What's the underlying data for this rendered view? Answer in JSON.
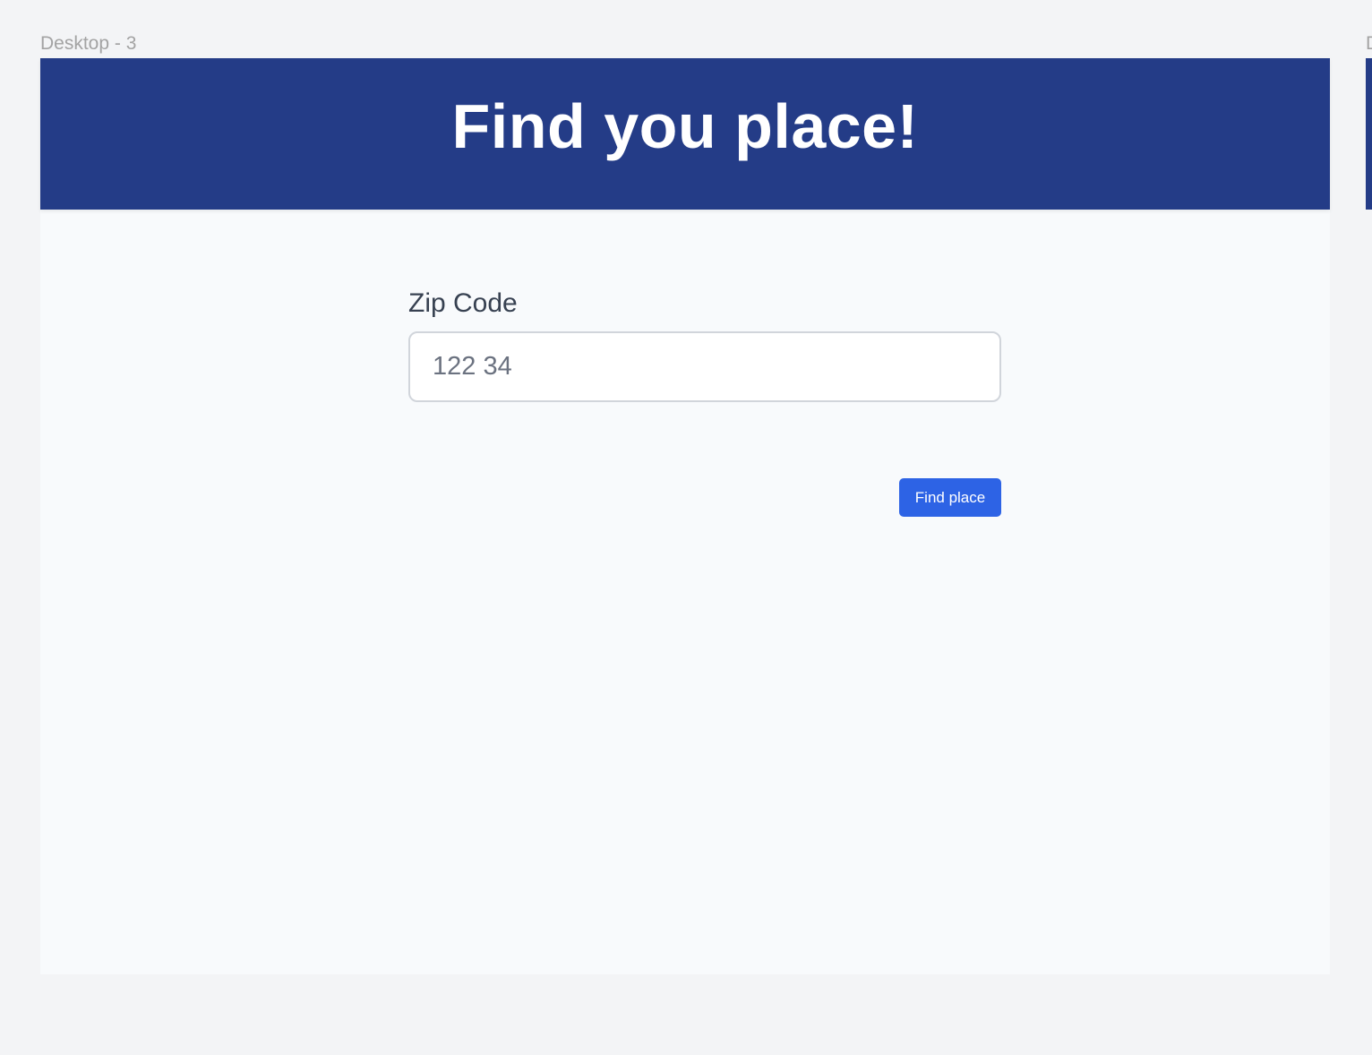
{
  "canvas": {
    "frame_label": "Desktop - 3",
    "next_frame_label": "D"
  },
  "header": {
    "title": "Find you place!"
  },
  "form": {
    "zip_label": "Zip Code",
    "zip_placeholder": "122 34",
    "zip_value": "",
    "submit_label": "Find place"
  },
  "colors": {
    "header_background": "#243c87",
    "button_background": "#2d63e5",
    "page_background": "#f8fafc",
    "canvas_background": "#f3f4f6"
  }
}
